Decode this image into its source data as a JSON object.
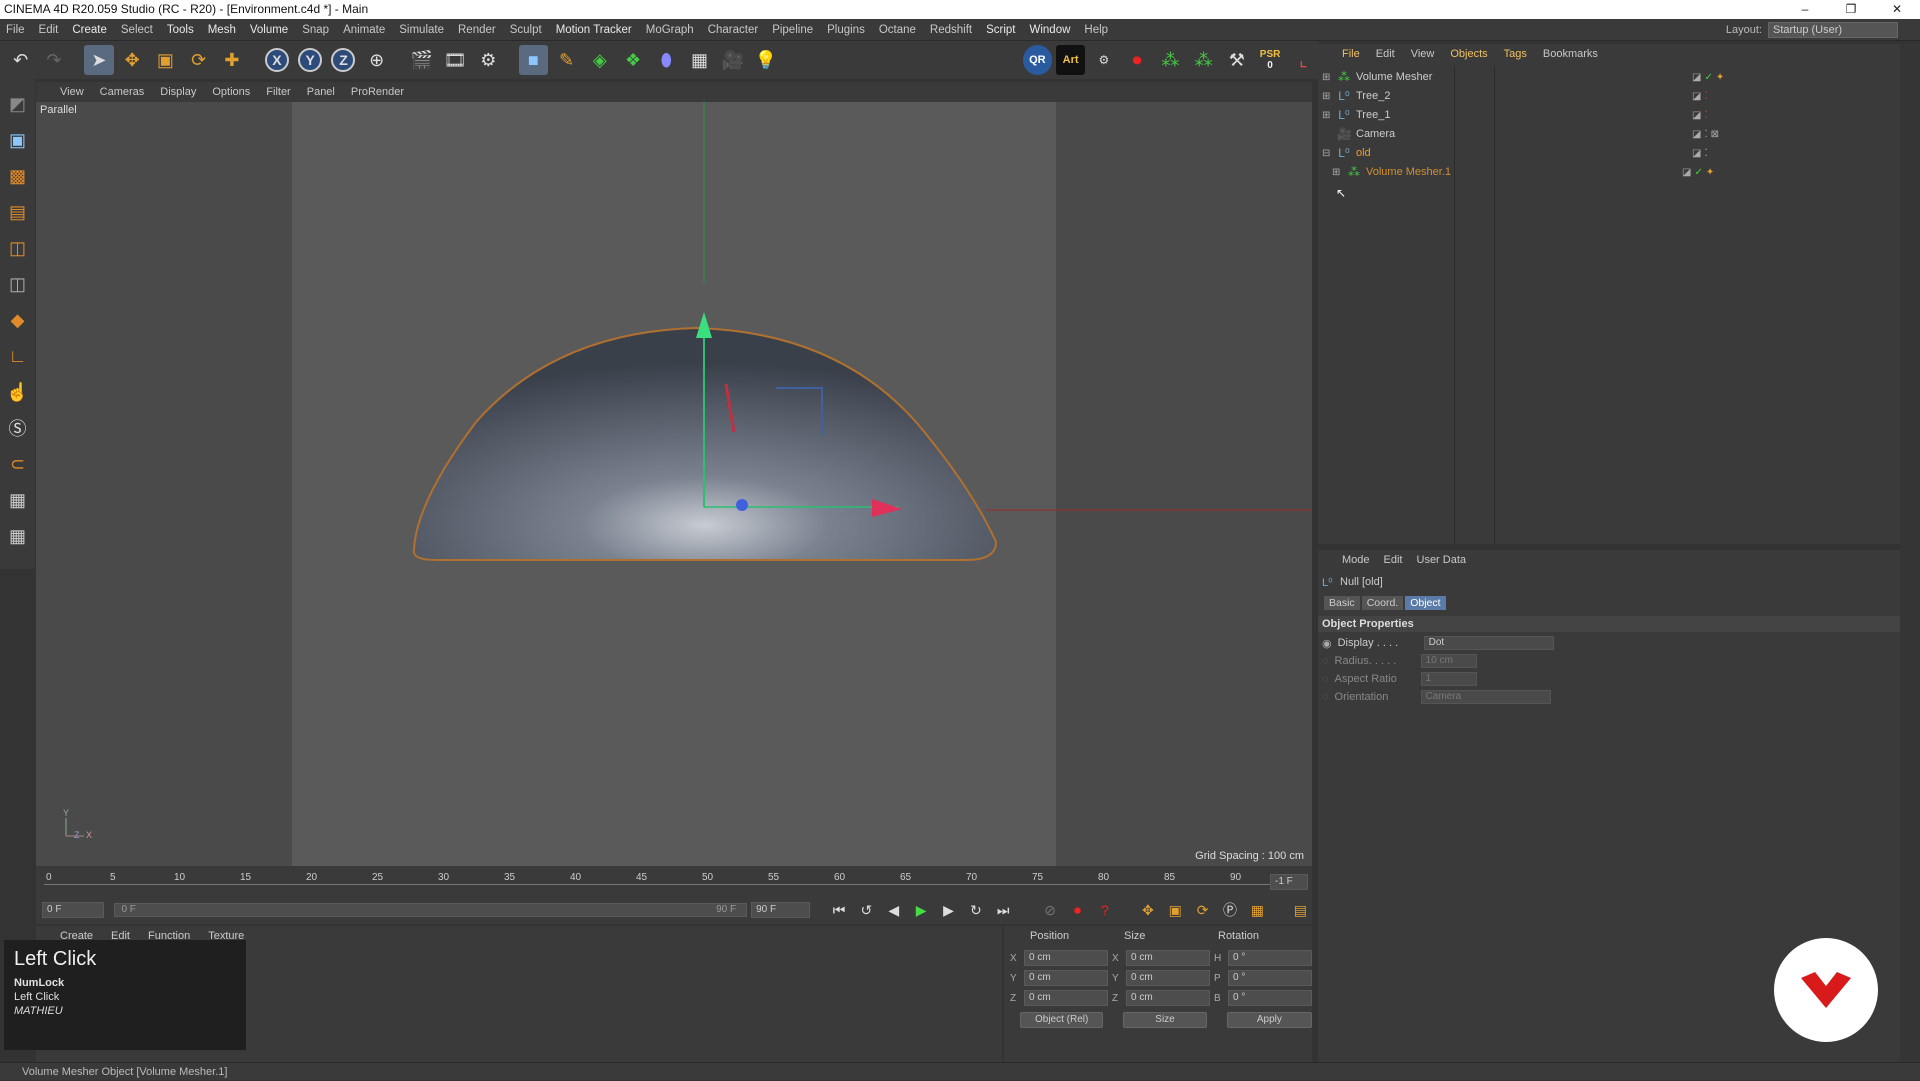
{
  "window": {
    "title": "CINEMA 4D R20.059 Studio (RC - R20) - [Environment.c4d *] - Main"
  },
  "menubar": {
    "items": [
      "File",
      "Edit",
      "Create",
      "Select",
      "Tools",
      "Mesh",
      "Volume",
      "Snap",
      "Animate",
      "Simulate",
      "Render",
      "Sculpt",
      "Motion Tracker",
      "MoGraph",
      "Character",
      "Pipeline",
      "Plugins",
      "Octane",
      "Redshift",
      "Script",
      "Window",
      "Help"
    ],
    "layout_label": "Layout:",
    "layout_value": "Startup (User)"
  },
  "toolbar": {
    "icons": [
      "undo-icon",
      "redo-icon",
      "select-icon",
      "move-icon",
      "scale-icon",
      "rotate-icon",
      "add-icon",
      "x-axis-icon",
      "y-axis-icon",
      "z-axis-icon",
      "world-icon",
      "render-view-icon",
      "render-picture-viewer-icon",
      "render-settings-icon",
      "cube-icon",
      "pen-icon",
      "subdivision-icon",
      "array-icon",
      "deformer-icon",
      "floor-icon",
      "camera-icon",
      "light-icon"
    ],
    "x_label": "X",
    "y_label": "Y",
    "z_label": "Z",
    "qr_label": "QR",
    "art_label": "Art",
    "psr_label": "PSR",
    "psr_value": "0"
  },
  "viewport": {
    "menu": [
      "View",
      "Cameras",
      "Display",
      "Options",
      "Filter",
      "Panel",
      "ProRender"
    ],
    "label": "Parallel",
    "grid_spacing": "Grid Spacing : 100 cm"
  },
  "timeline": {
    "ticks": [
      "0",
      "5",
      "10",
      "15",
      "20",
      "25",
      "30",
      "35",
      "40",
      "45",
      "50",
      "55",
      "60",
      "65",
      "70",
      "75",
      "80",
      "85",
      "90"
    ],
    "current_frame_right": "-1 F",
    "start_field": "0 F",
    "slider_start": "0 F",
    "slider_end": "90 F",
    "end_field": "90 F"
  },
  "material_manager": {
    "menu": [
      "Create",
      "Edit",
      "Function",
      "Texture"
    ]
  },
  "coordinates": {
    "headers": [
      "Position",
      "Size",
      "Rotation"
    ],
    "rows": [
      {
        "axis": "X",
        "pos": "0 cm",
        "size_axis": "X",
        "size": "0 cm",
        "rot_axis": "H",
        "rot": "0 °"
      },
      {
        "axis": "Y",
        "pos": "0 cm",
        "size_axis": "Y",
        "size": "0 cm",
        "rot_axis": "P",
        "rot": "0 °"
      },
      {
        "axis": "Z",
        "pos": "0 cm",
        "size_axis": "Z",
        "size": "0 cm",
        "rot_axis": "B",
        "rot": "0 °"
      }
    ],
    "mode_select": "Object (Rel)",
    "size_select": "Size",
    "apply": "Apply"
  },
  "object_manager": {
    "menu": [
      "File",
      "Edit",
      "View",
      "Objects",
      "Tags",
      "Bookmarks"
    ],
    "objects": [
      {
        "name": "Volume Mesher",
        "icon": "volume-mesher-icon",
        "highlight": false
      },
      {
        "name": "Tree_2",
        "icon": "null-icon",
        "highlight": false
      },
      {
        "name": "Tree_1",
        "icon": "null-icon",
        "highlight": false
      },
      {
        "name": "Camera",
        "icon": "camera-icon",
        "highlight": false
      },
      {
        "name": "old",
        "icon": "null-icon",
        "highlight": true
      },
      {
        "name": "Volume Mesher.1",
        "icon": "volume-mesher-icon",
        "highlight": true
      }
    ]
  },
  "attribute_manager": {
    "menu": [
      "Mode",
      "Edit",
      "User Data"
    ],
    "title": "Null [old]",
    "tabs": [
      "Basic",
      "Coord.",
      "Object"
    ],
    "section": "Object Properties",
    "props": [
      {
        "label": "Display . . . .",
        "value": "Dot"
      },
      {
        "label": "Radius. . . . .",
        "value": "10 cm"
      },
      {
        "label": "Aspect Ratio",
        "value": "1"
      },
      {
        "label": "Orientation",
        "value": "Camera"
      }
    ]
  },
  "statusbar": {
    "text": "Volume Mesher Object [Volume Mesher.1]"
  },
  "keycast": {
    "action": "Left Click",
    "key1": "NumLock",
    "key2": "Left Click",
    "user": "MATHIEU"
  },
  "colors": {
    "accent": "#e08a2a",
    "selected_object": "#f0a020",
    "logo_red": "#d81a1a"
  }
}
